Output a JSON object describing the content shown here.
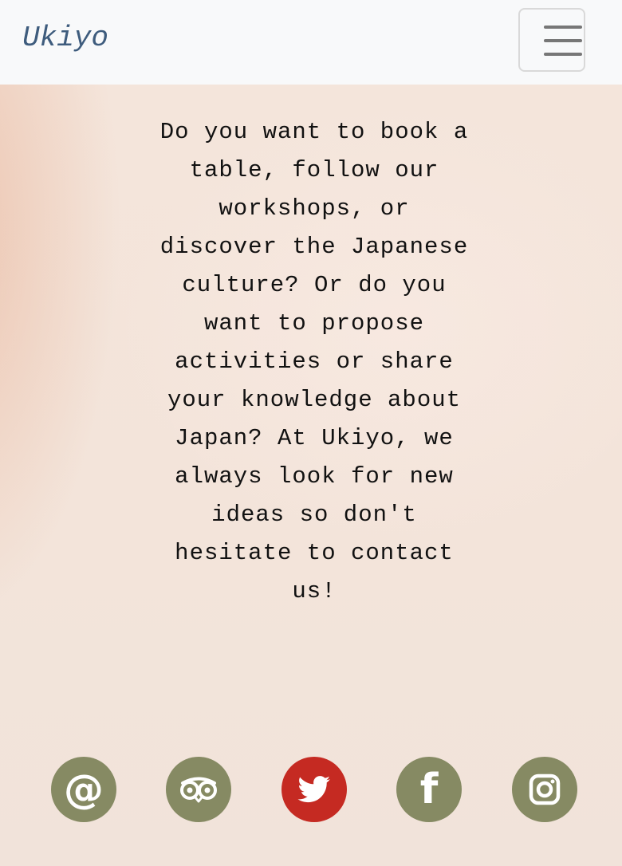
{
  "navbar": {
    "brand": "Ukiyo",
    "toggler_icon": "hamburger-menu-icon"
  },
  "main": {
    "message": "Do you want to book a table, follow our workshops, or discover the Japanese culture? Or do you want to propose activities or share your knowledge about Japan? At Ukiyo, we always look for new ideas so don't hesitate to contact us!"
  },
  "socials": [
    {
      "name": "email",
      "icon": "at-sign-icon",
      "glyph": "@",
      "color": "#868a63"
    },
    {
      "name": "tripadvisor",
      "icon": "tripadvisor-owl-icon",
      "color": "#868a63"
    },
    {
      "name": "twitter",
      "icon": "twitter-bird-icon",
      "color": "#c52a22"
    },
    {
      "name": "facebook",
      "icon": "facebook-f-icon",
      "glyph": "f",
      "color": "#868a63"
    },
    {
      "name": "instagram",
      "icon": "instagram-camera-icon",
      "color": "#868a63"
    }
  ],
  "colors": {
    "navbar_bg": "#f8f9fa",
    "brand": "#3e5c7d",
    "page_bg": "#f3e6dc",
    "social_default": "#868a63",
    "social_active": "#c52a22"
  }
}
